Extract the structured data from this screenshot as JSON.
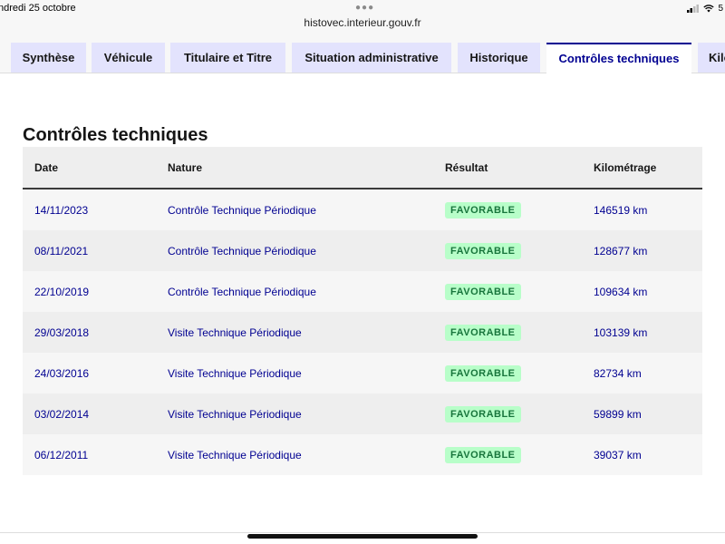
{
  "statusbar": {
    "time_text": "ndredi 25 octobre",
    "url": "histovec.interieur.gouv.fr",
    "battery_text": "5"
  },
  "tabs": [
    {
      "label": "Synthèse",
      "active": false
    },
    {
      "label": "Véhicule",
      "active": false
    },
    {
      "label": "Titulaire et Titre",
      "active": false
    },
    {
      "label": "Situation administrative",
      "active": false
    },
    {
      "label": "Historique",
      "active": false
    },
    {
      "label": "Contrôles techniques",
      "active": true
    },
    {
      "label": "Kilo",
      "active": false
    }
  ],
  "main": {
    "title": "Contrôles techniques",
    "table": {
      "headers": [
        "Date",
        "Nature",
        "Résultat",
        "Kilométrage"
      ],
      "rows": [
        {
          "date": "14/11/2023",
          "nature": "Contrôle Technique Périodique",
          "result": "FAVORABLE",
          "km": "146519 km"
        },
        {
          "date": "08/11/2021",
          "nature": "Contrôle Technique Périodique",
          "result": "FAVORABLE",
          "km": "128677 km"
        },
        {
          "date": "22/10/2019",
          "nature": "Contrôle Technique Périodique",
          "result": "FAVORABLE",
          "km": "109634 km"
        },
        {
          "date": "29/03/2018",
          "nature": "Visite Technique Périodique",
          "result": "FAVORABLE",
          "km": "103139 km"
        },
        {
          "date": "24/03/2016",
          "nature": "Visite Technique Périodique",
          "result": "FAVORABLE",
          "km": "82734 km"
        },
        {
          "date": "03/02/2014",
          "nature": "Visite Technique Périodique",
          "result": "FAVORABLE",
          "km": "59899 km"
        },
        {
          "date": "06/12/2011",
          "nature": "Visite Technique Périodique",
          "result": "FAVORABLE",
          "km": "39037 km"
        }
      ]
    }
  },
  "colors": {
    "accent": "#000091",
    "tab_bg": "#e3e3fd",
    "badge_bg": "#b8fec9",
    "badge_text": "#18753c"
  }
}
